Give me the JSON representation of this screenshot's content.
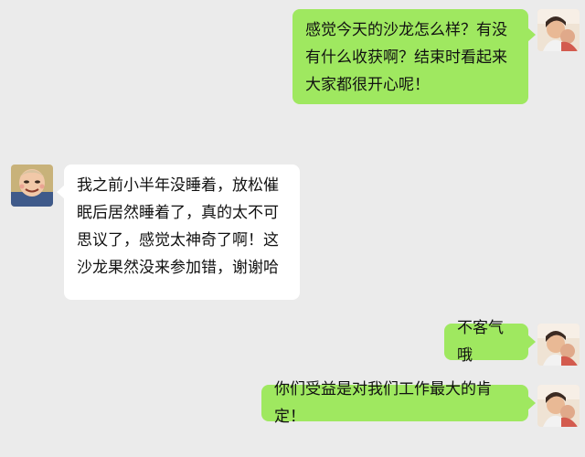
{
  "chat": {
    "messages": [
      {
        "side": "sent",
        "text": "感觉今天的沙龙怎么样？有没有什么收获啊？结束时看起来大家都很开心呢！"
      },
      {
        "side": "received",
        "text": "我之前小半年没睡着，放松催眠后居然睡着了，真的太不可思议了，感觉太神奇了啊！这沙龙果然没来参加错，谢谢哈"
      },
      {
        "side": "sent",
        "text": "不客气哦"
      },
      {
        "side": "sent",
        "text": "你们受益是对我们工作最大的肯定！"
      }
    ]
  },
  "colors": {
    "background": "#ebebeb",
    "sent_bubble": "#9fe860",
    "received_bubble": "#ffffff"
  },
  "icons": {
    "self_avatar": "child-photo-avatar",
    "contact_avatar": "cartoon-avatar"
  }
}
